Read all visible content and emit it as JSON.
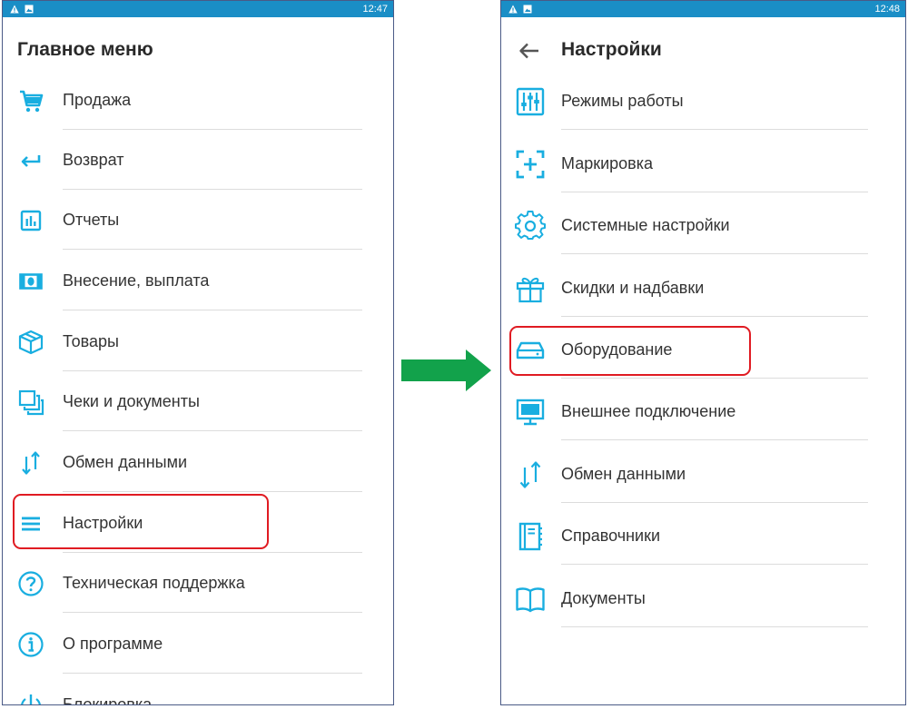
{
  "colors": {
    "accent": "#19aee0",
    "status_bar": "#1a8ec6",
    "highlight": "#e01b22",
    "arrow": "#12a24b"
  },
  "left_screen": {
    "status_time": "12:47",
    "title": "Главное меню",
    "highlighted_item": "Настройки",
    "items": [
      {
        "label": "Продажа",
        "icon": "cart-icon"
      },
      {
        "label": "Возврат",
        "icon": "return-arrow-icon"
      },
      {
        "label": "Отчеты",
        "icon": "report-chart-icon"
      },
      {
        "label": "Внесение, выплата",
        "icon": "cash-banknote-icon"
      },
      {
        "label": "Товары",
        "icon": "box-icon"
      },
      {
        "label": "Чеки и документы",
        "icon": "documents-stack-icon"
      },
      {
        "label": "Обмен данными",
        "icon": "exchange-arrows-icon"
      },
      {
        "label": "Настройки",
        "icon": "menu-lines-icon"
      },
      {
        "label": "Техническая поддержка",
        "icon": "question-circle-icon"
      },
      {
        "label": "О программе",
        "icon": "info-circle-icon"
      },
      {
        "label": "Блокировка",
        "icon": "power-icon"
      }
    ]
  },
  "right_screen": {
    "status_time": "12:48",
    "title": "Настройки",
    "highlighted_item": "Оборудование",
    "items": [
      {
        "label": "Режимы работы",
        "icon": "sliders-icon"
      },
      {
        "label": "Маркировка",
        "icon": "scan-frame-icon"
      },
      {
        "label": "Системные настройки",
        "icon": "gear-icon"
      },
      {
        "label": "Скидки и надбавки",
        "icon": "gift-icon"
      },
      {
        "label": "Оборудование",
        "icon": "hardware-drive-icon"
      },
      {
        "label": "Внешнее подключение",
        "icon": "monitor-icon"
      },
      {
        "label": "Обмен данными",
        "icon": "exchange-arrows-icon"
      },
      {
        "label": "Справочники",
        "icon": "notebook-icon"
      },
      {
        "label": "Документы",
        "icon": "open-book-icon"
      }
    ]
  }
}
